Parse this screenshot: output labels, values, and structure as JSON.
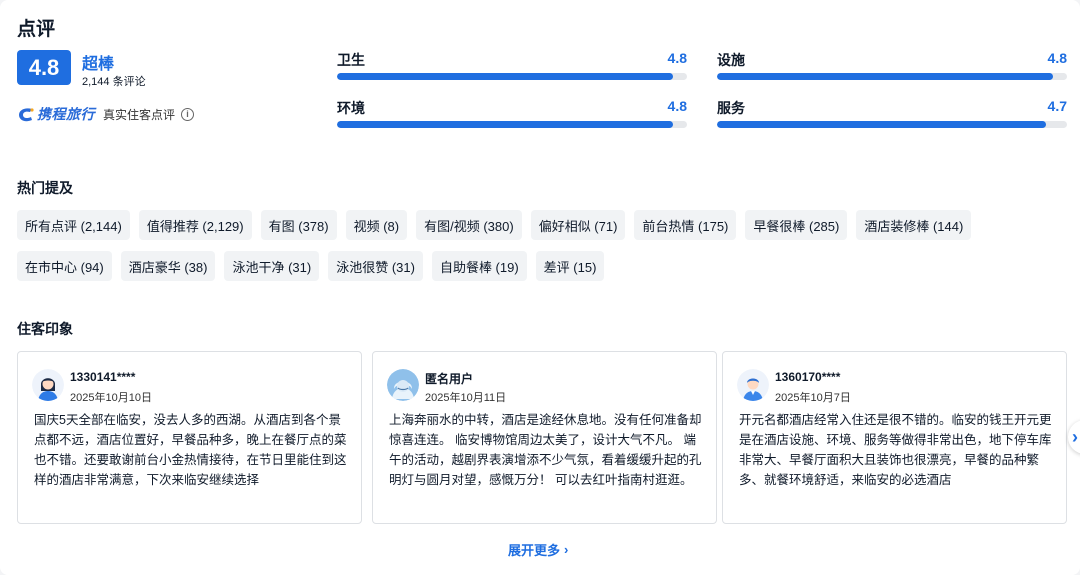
{
  "section_title": "点评",
  "overall": {
    "score": "4.8",
    "word": "超棒",
    "count": "2,144 条评论"
  },
  "brand": {
    "logo_text": "携程旅行",
    "label": "真实住客点评",
    "info_icon": "info-icon"
  },
  "metrics": [
    {
      "label": "卫生",
      "value": "4.8",
      "fraction": 0.96
    },
    {
      "label": "设施",
      "value": "4.8",
      "fraction": 0.96
    },
    {
      "label": "环境",
      "value": "4.8",
      "fraction": 0.96
    },
    {
      "label": "服务",
      "value": "4.7",
      "fraction": 0.94
    }
  ],
  "hot_mentions": {
    "title": "热门提及",
    "row1": [
      "所有点评 (2,144)",
      "值得推荐 (2,129)",
      "有图 (378)",
      "视频 (8)",
      "有图/视频 (380)",
      "偏好相似 (71)",
      "前台热情 (175)",
      "早餐很棒 (285)",
      "酒店装修棒 (144)"
    ],
    "row2": [
      "在市中心 (94)",
      "酒店豪华 (38)",
      "泳池干净 (31)",
      "泳池很赞 (31)",
      "自助餐棒 (19)",
      "差评 (15)"
    ]
  },
  "impressions": {
    "title": "住客印象",
    "reviews": [
      {
        "user": "1330141****",
        "date": "2025年10月10日",
        "text": "国庆5天全部在临安，没去人多的西湖。从酒店到各个景点都不远，酒店位置好，早餐品种多，晚上在餐厅点的菜也不错。还要敢谢前台小金热情接待，在节日里能住到这样的酒店非常满意，下次来临安继续选择"
      },
      {
        "user": "匿名用户",
        "date": "2025年10月11日",
        "text": "上海奔丽水的中转，酒店是途经休息地。没有任何准备却惊喜连连。 临安博物馆周边太美了，设计大气不凡。 端午的活动，越剧界表演增添不少气氛，看着缓缓升起的孔明灯与圆月对望，感慨万分！ 可以去红叶指南村逛逛。"
      },
      {
        "user": "1360170****",
        "date": "2025年10月7日",
        "text": "开元名都酒店经常入住还是很不错的。临安的钱王开元更是在酒店设施、环境、服务等做得非常出色，地下停车库非常大、早餐厅面积大且装饰也很漂亮，早餐的品种繁多、就餐环境舒适，来临安的必选酒店"
      }
    ],
    "next_icon": "chevron-right-icon"
  },
  "expand": {
    "label": "展开更多",
    "icon": "chevron-right-icon"
  },
  "colors": {
    "accent": "#1f6ee0",
    "bar_track": "#e6e8eb",
    "tag_bg": "#f1f3f5"
  }
}
